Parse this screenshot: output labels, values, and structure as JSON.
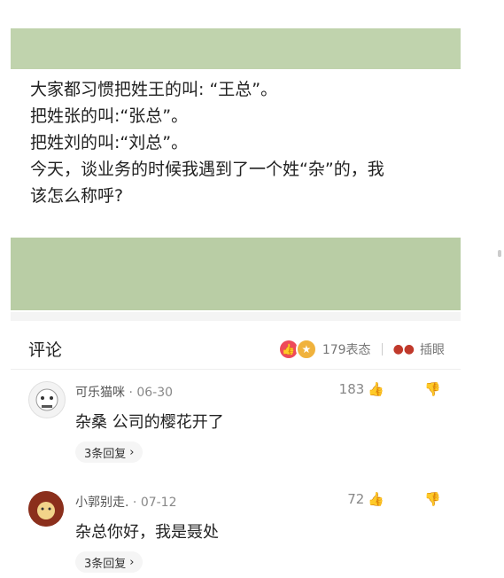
{
  "post": {
    "lines": [
      "大家都习惯把姓王的叫: “王总”。",
      "把姓张的叫:“张总”。",
      "把姓刘的叫:“刘总”。",
      "今天，谈业务的时候我遇到了一个姓“杂”的，我",
      "该怎么称呼?"
    ]
  },
  "comments_header": {
    "title": "评论",
    "reactions_count": "179表态",
    "insert_eyes": "插眼"
  },
  "comments": [
    {
      "username": "可乐猫咪",
      "dot": "·",
      "date": "06-30",
      "text": "杂桑 公司的樱花开了",
      "likes": "183",
      "replies": "3条回复",
      "chevron": "›"
    },
    {
      "username": "小郭别走.",
      "dot": "·",
      "date": "07-12",
      "text": "杂总你好，我是聂处",
      "likes": "72",
      "replies": "3条回复",
      "chevron": "›"
    }
  ],
  "icons": {
    "thumb_up": "thumb-up-icon",
    "thumb_down": "thumb-down-icon",
    "like_reaction": "like-reaction-icon",
    "fun_reaction": "fun-reaction-icon",
    "eyes": "eyes-icon"
  }
}
